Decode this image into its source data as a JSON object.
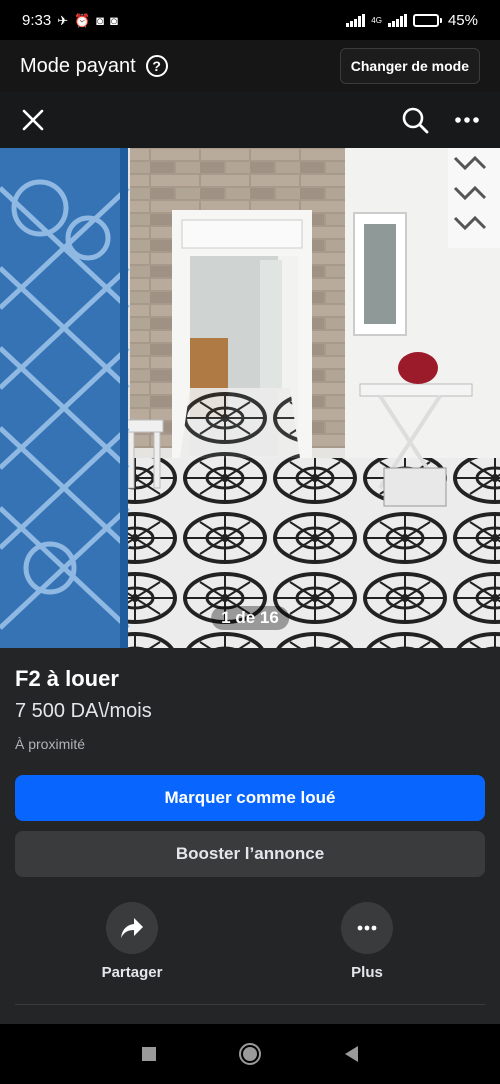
{
  "status": {
    "time": "9:33",
    "network": "4G",
    "battery_text": "45%",
    "battery_level": 0.45
  },
  "mode_bar": {
    "label": "Mode payant",
    "help_icon": "question-circle-icon",
    "change_button": "Changer de mode"
  },
  "top_bar": {
    "close_icon": "close-icon",
    "search_icon": "search-icon",
    "more_icon": "more-horizontal-icon"
  },
  "photo": {
    "counter": "1 de 16"
  },
  "listing": {
    "title": "F2 à louer",
    "price": "7 500 DA\\/mois",
    "location": "À proximité"
  },
  "buttons": {
    "mark_rented": "Marquer comme loué",
    "boost": "Booster l’annonce"
  },
  "actions": [
    {
      "label": "Partager",
      "icon": "share-icon"
    },
    {
      "label": "Plus",
      "icon": "more-horizontal-icon"
    }
  ],
  "colors": {
    "primary_button": "#0866ff",
    "surface": "#242526",
    "secondary_button": "#3a3b3c"
  }
}
